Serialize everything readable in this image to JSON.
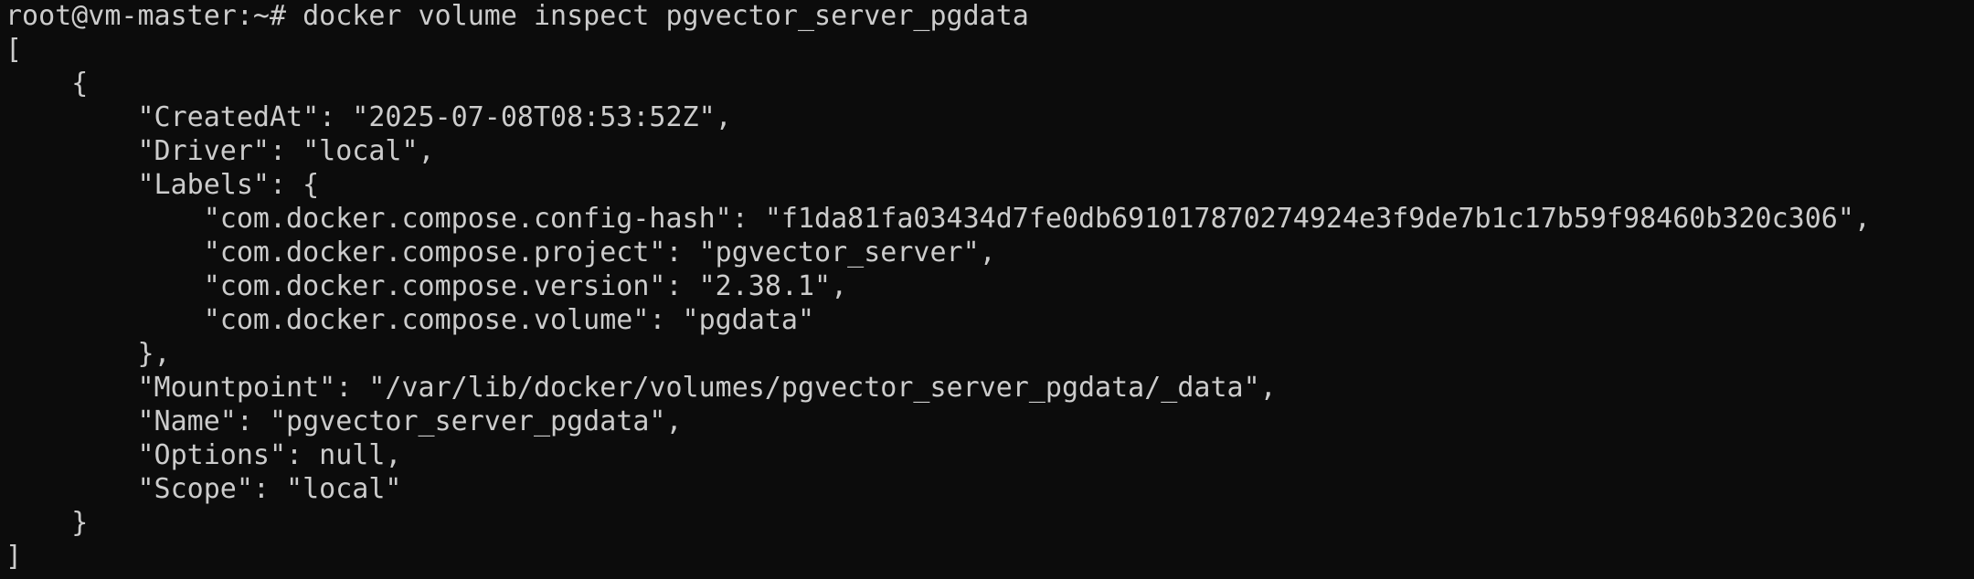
{
  "terminal": {
    "lines": [
      "root@vm-master:~# docker volume inspect pgvector_server_pgdata",
      "[",
      "    {",
      "        \"CreatedAt\": \"2025-07-08T08:53:52Z\",",
      "        \"Driver\": \"local\",",
      "        \"Labels\": {",
      "            \"com.docker.compose.config-hash\": \"f1da81fa03434d7fe0db691017870274924e3f9de7b1c17b59f98460b320c306\",",
      "            \"com.docker.compose.project\": \"pgvector_server\",",
      "            \"com.docker.compose.version\": \"2.38.1\",",
      "            \"com.docker.compose.volume\": \"pgdata\"",
      "        },",
      "        \"Mountpoint\": \"/var/lib/docker/volumes/pgvector_server_pgdata/_data\",",
      "        \"Name\": \"pgvector_server_pgdata\",",
      "        \"Options\": null,",
      "        \"Scope\": \"local\"",
      "    }",
      "]"
    ]
  }
}
